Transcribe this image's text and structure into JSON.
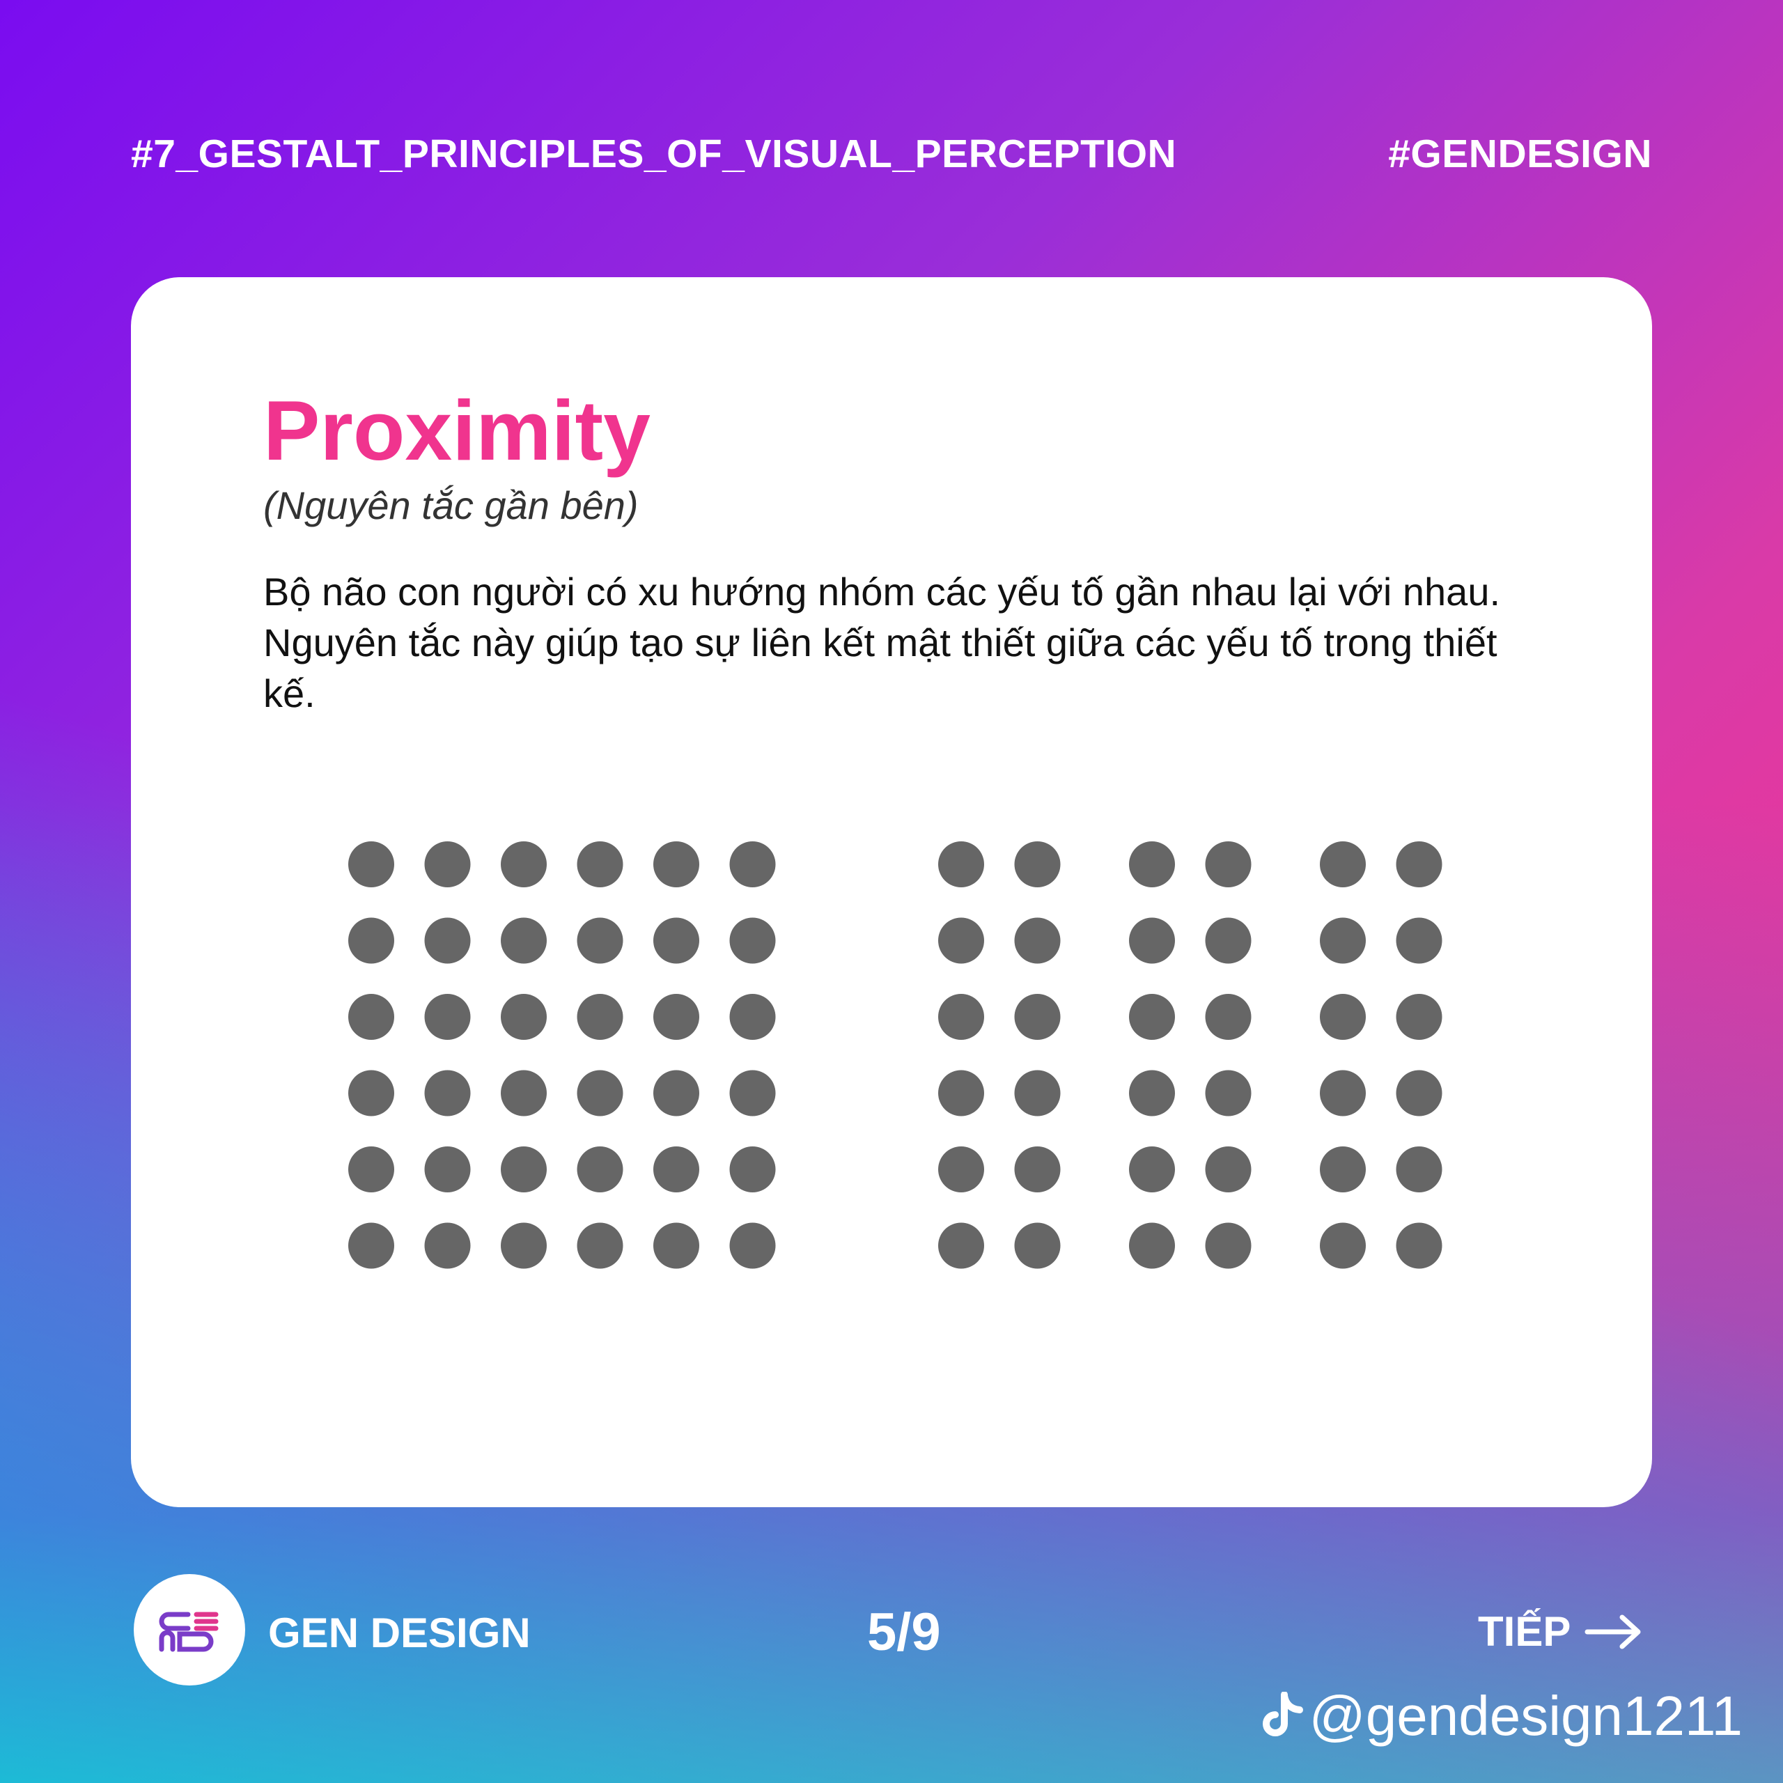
{
  "header": {
    "series_tag": "#7_GESTALT_PRINCIPLES_OF_VISUAL_PERCEPTION",
    "brand_tag": "#GENDESIGN"
  },
  "card": {
    "title": "Proximity",
    "subtitle": "(Nguyên tắc gần bên)",
    "description": "Bộ não con người có xu hướng nhóm các yếu tố gần nhau lại với nhau. Nguyên tắc này giúp tạo sự liên kết mật thiết giữa các yếu tố trong thiết kế.",
    "illustration": {
      "dot_color": "#666666",
      "left_grid": {
        "rows": 6,
        "cols": 6
      },
      "right_grid": {
        "rows": 6,
        "groups": 3,
        "cols_per_group": 2
      }
    }
  },
  "footer": {
    "logo_icon": "gen-design-logo-icon",
    "brand_name": "GEN DESIGN",
    "page_indicator": "5/9",
    "next_label": "TIẾP",
    "next_icon": "arrow-right-icon",
    "social_icon": "tiktok-icon",
    "social_handle": "@gendesign1211"
  },
  "colors": {
    "title_accent": "#f0348e",
    "gradient_start": "#7a0cf0",
    "gradient_end": "#ff3388"
  }
}
